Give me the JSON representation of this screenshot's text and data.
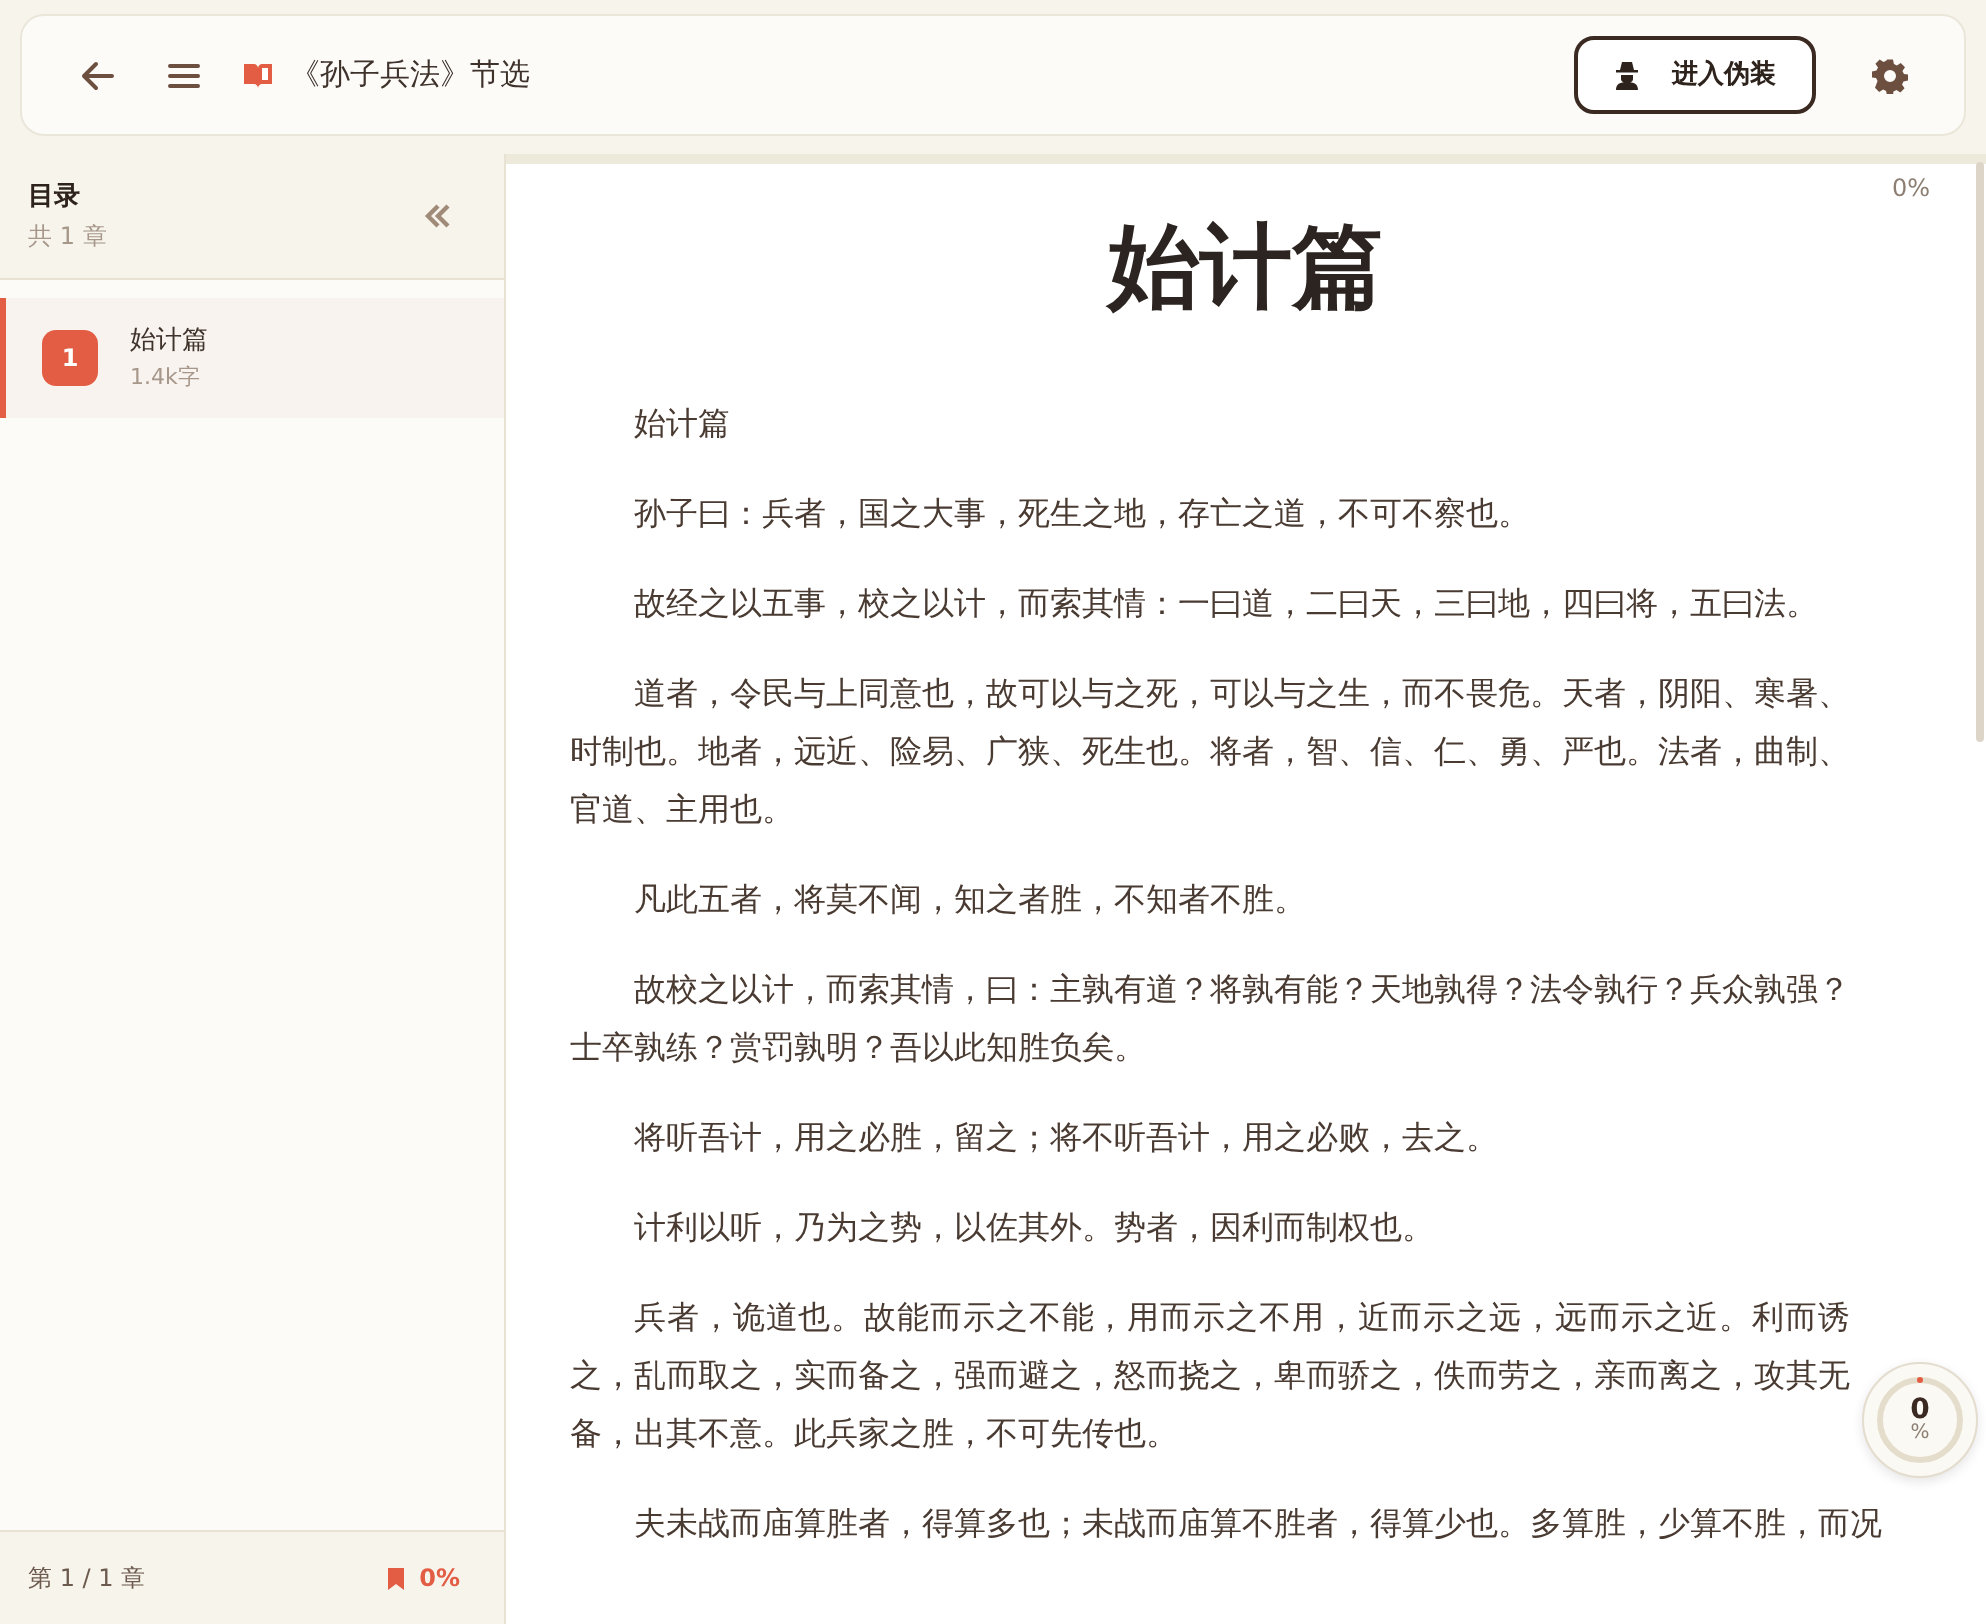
{
  "header": {
    "book_title": "《孙子兵法》节选",
    "disguise_button": "进入伪装"
  },
  "sidebar": {
    "title": "目录",
    "count": "共 1 章",
    "chapters": [
      {
        "number": "1",
        "title": "始计篇",
        "words": "1.4k字",
        "selected": true
      }
    ],
    "footer": {
      "position": "第 1 / 1 章",
      "progress": "0%"
    }
  },
  "reader": {
    "progress_label": "0%",
    "title": "始计篇",
    "paragraphs": [
      "始计篇",
      "孙子曰：兵者，国之大事，死生之地，存亡之道，不可不察也。",
      "故经之以五事，校之以计，而索其情：一曰道，二曰天，三曰地，四曰将，五曰法。",
      "道者，令民与上同意也，故可以与之死，可以与之生，而不畏危。天者，阴阳、寒暑、时制也。地者，远近、险易、广狭、死生也。将者，智、信、仁、勇、严也。法者，曲制、官道、主用也。",
      "凡此五者，将莫不闻，知之者胜，不知者不胜。",
      "故校之以计，而索其情，曰：主孰有道？将孰有能？天地孰得？法令孰行？兵众孰强？士卒孰练？赏罚孰明？吾以此知胜负矣。",
      "将听吾计，用之必胜，留之；将不听吾计，用之必败，去之。",
      "计利以听，乃为之势，以佐其外。势者，因利而制权也。",
      "兵者，诡道也。故能而示之不能，用而示之不用，近而示之远，远而示之近。利而诱之，乱而取之，实而备之，强而避之，怒而挠之，卑而骄之，佚而劳之，亲而离之，攻其无备，出其不意。此兵家之胜，不可先传也。",
      "夫未战而庙算胜者，得算多也；未战而庙算不胜者，得算少也。多算胜，少算不胜，而况"
    ],
    "progress_ring": {
      "value": "0",
      "unit": "%",
      "level": 0
    }
  }
}
